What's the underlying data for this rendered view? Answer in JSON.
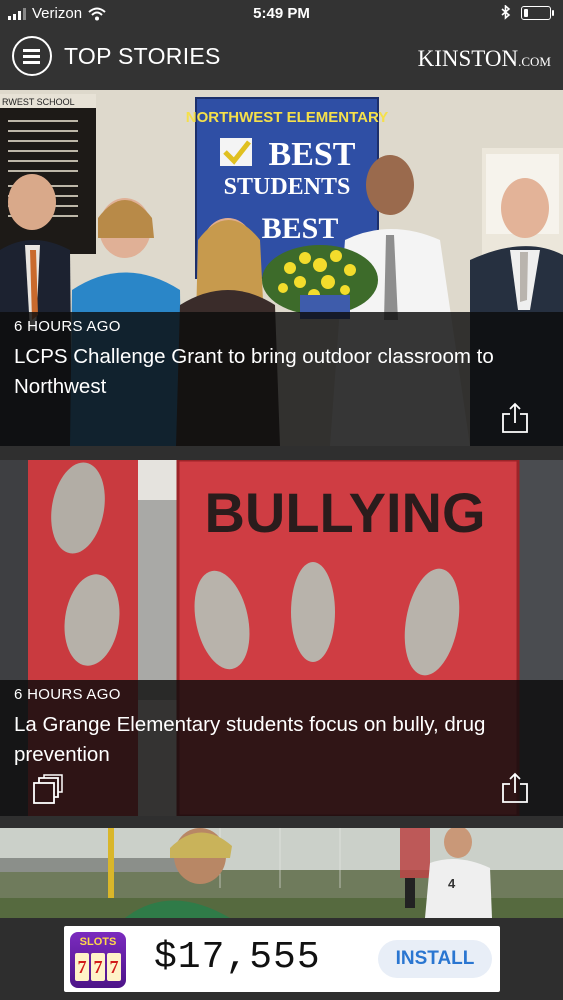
{
  "status_bar": {
    "carrier": "Verizon",
    "time": "5:49 PM",
    "icons": [
      "signal-icon",
      "wifi-icon",
      "bluetooth-icon",
      "battery-icon"
    ],
    "battery_level": 0.15
  },
  "nav": {
    "title": "TOP STORIES",
    "brand_main": "KINSTON",
    "brand_suffix": ".COM",
    "menu_icon": "hamburger-menu-icon"
  },
  "stories": [
    {
      "time_ago": "6 HOURS AGO",
      "headline": "LCPS Challenge Grant to bring outdoor classroom to Northwest",
      "photo_text": {
        "banner_line1": "NORTHWEST ELEMENTARY",
        "banner_line2": "BEST",
        "banner_line3": "STUDENTS",
        "banner_line4": "BEST",
        "board_text": "RWEST SCHOOL"
      }
    },
    {
      "time_ago": "6 HOURS AGO",
      "headline": "La Grange Elementary students focus on bully, drug prevention",
      "photo_text": {
        "banner": "BULLYING"
      }
    }
  ],
  "peek_story": {
    "photo_text": {
      "jersey_number": "4"
    }
  },
  "ad": {
    "logo_text": "SLOTS",
    "logo_reels": [
      "7",
      "7",
      "7"
    ],
    "amount": "$17,555",
    "install_label": "INSTALL"
  },
  "colors": {
    "bar_background": "#333333",
    "overlay": "#0c0c0c",
    "install_text": "#2a76d1",
    "bullying_red": "#c93a3f",
    "banner_blue": "#2f4fa5"
  }
}
